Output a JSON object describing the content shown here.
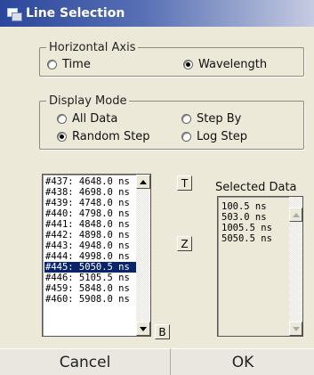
{
  "window": {
    "title": "Line Selection"
  },
  "horizontal_axis": {
    "legend": "Horizontal Axis",
    "options": [
      {
        "label": "Time",
        "checked": false
      },
      {
        "label": "Wavelength",
        "checked": true
      }
    ]
  },
  "display_mode": {
    "legend": "Display Mode",
    "options": [
      {
        "label": "All Data",
        "checked": false
      },
      {
        "label": "Step By",
        "checked": false
      },
      {
        "label": "Random Step",
        "checked": true
      },
      {
        "label": "Log Step",
        "checked": false
      }
    ]
  },
  "line_list": {
    "selected_index": 8,
    "items": [
      "#437: 4648.0 ns",
      "#438: 4698.0 ns",
      "#439: 4748.0 ns",
      "#440: 4798.0 ns",
      "#441: 4848.0 ns",
      "#442: 4898.0 ns",
      "#443: 4948.0 ns",
      "#444: 4998.0 ns",
      "#445: 5050.5 ns",
      "#446: 5105.5 ns",
      "#459: 5848.0 ns",
      "#460: 5908.0 ns"
    ]
  },
  "side_buttons": {
    "top": "T",
    "zoom": "Z",
    "bottom": "B"
  },
  "selected_data": {
    "label": "Selected Data",
    "items": [
      "100.5 ns",
      "503.0 ns",
      "1005.5 ns",
      "5050.5 ns"
    ]
  },
  "buttons": {
    "cancel": "Cancel",
    "ok": "OK"
  }
}
